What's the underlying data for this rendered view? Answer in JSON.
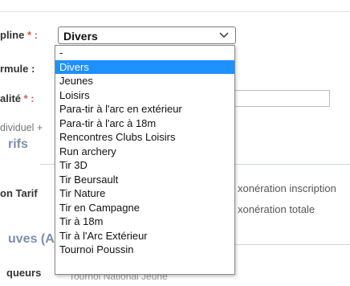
{
  "labels": {
    "discipline": "pline",
    "discipline_req": " * :",
    "formule": "rmule :",
    "qualite": "alité",
    "qualite_req": " * :",
    "individuel": "dividuel +",
    "section_tarifs": "rifs",
    "tarif": "on Tarif",
    "section_epreuves": "uves (A",
    "marqueurs": "queurs",
    "exo_inscription": "xonération inscription",
    "exo_totale": "xonération totale",
    "tournoi_label": "Tournoi National Jeune"
  },
  "select": {
    "value": "Divers",
    "options": [
      "-",
      "Divers",
      "Jeunes",
      "Loisirs",
      "Para-tir à l'arc en extérieur",
      "Para-tir à l'arc à 18m",
      "Rencontres Clubs Loisirs",
      "Run archery",
      "Tir 3D",
      "Tir Beursault",
      "Tir Nature",
      "Tir en Campagne",
      "Tir à 18m",
      "Tir à l'Arc Extérieur",
      "Tournoi Poussin"
    ],
    "selected_index": 1
  },
  "colors": {
    "highlight": "#1e90ff",
    "section": "#7d8fae",
    "required": "#d9534f"
  },
  "icons": {
    "select_arrow": "chevron-down-icon"
  }
}
